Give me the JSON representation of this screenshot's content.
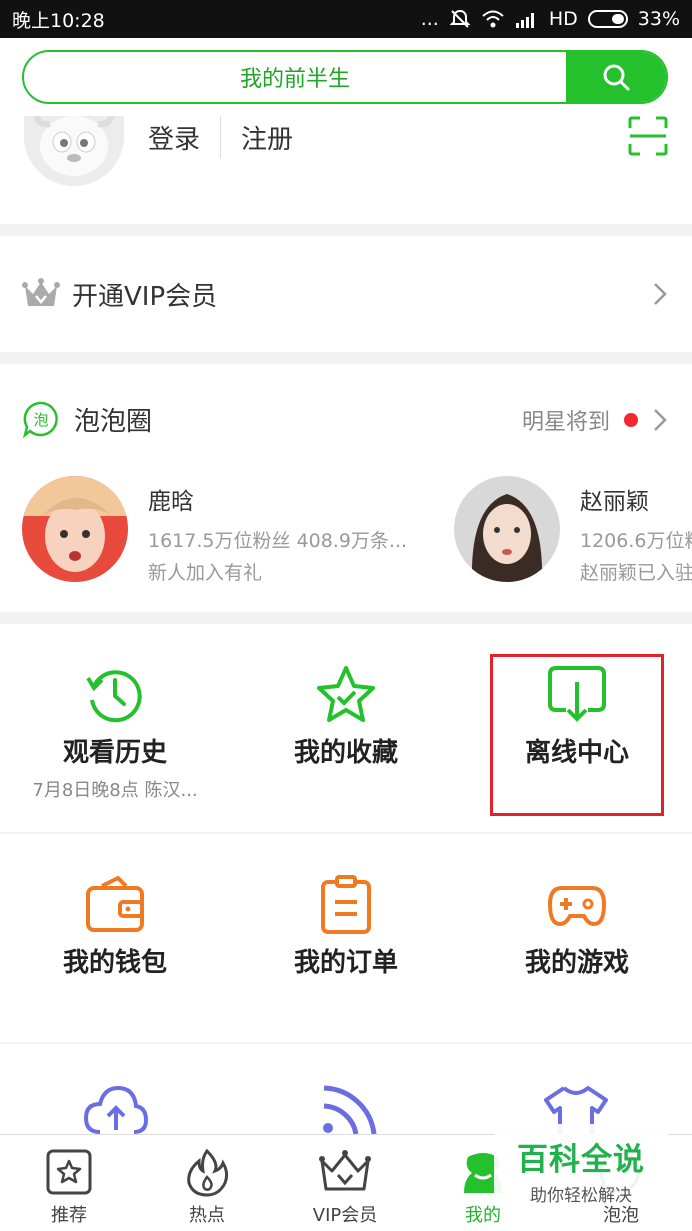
{
  "status_bar": {
    "time": "晚上10:28",
    "dots": "...",
    "network": "HD",
    "battery": "33%"
  },
  "search": {
    "text": "我的前半生"
  },
  "profile": {
    "login": "登录",
    "register": "注册"
  },
  "vip": {
    "label": "开通VIP会员"
  },
  "paopao": {
    "title": "泡泡圈",
    "badge_icon_text": "泡",
    "right_text": "明星将到",
    "stars": [
      {
        "name": "鹿晗",
        "fans": "1617.5万位粉丝 408.9万条...",
        "sub": "新人加入有礼"
      },
      {
        "name": "赵丽颖",
        "fans": "1206.6万位粉",
        "sub": "赵丽颖已入驻"
      }
    ]
  },
  "grid_row1": [
    {
      "label": "观看历史",
      "hint": "7月8日晚8点 陈汉..."
    },
    {
      "label": "我的收藏"
    },
    {
      "label": "离线中心"
    }
  ],
  "grid_row2": [
    {
      "label": "我的钱包"
    },
    {
      "label": "我的订单"
    },
    {
      "label": "我的游戏"
    }
  ],
  "tabs": [
    {
      "label": "推荐",
      "icon": "star-icon"
    },
    {
      "label": "热点",
      "icon": "flame-icon"
    },
    {
      "label": "VIP会员",
      "icon": "crown-icon"
    },
    {
      "label": "我的",
      "icon": "user-icon"
    },
    {
      "label": "泡泡",
      "icon": "bubble-icon"
    }
  ],
  "watermark": {
    "title": "百科全说",
    "subtitle": "助你轻松解决"
  },
  "colors": {
    "accent": "#25c12d",
    "orange": "#f07a22",
    "purple": "#6b6ee0",
    "highlight": "#e0222b"
  }
}
